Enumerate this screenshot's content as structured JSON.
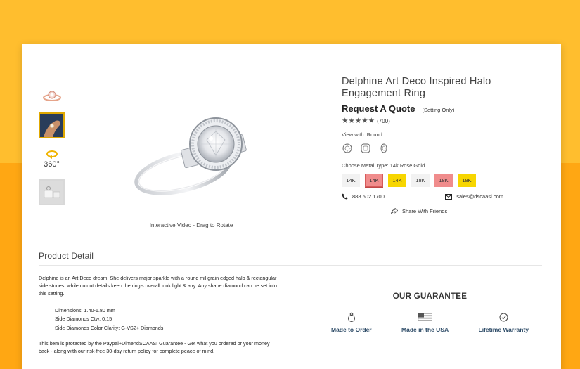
{
  "product": {
    "title": "Delphine Art Deco Inspired Halo Engagement Ring",
    "quote_label": "Request A Quote",
    "setting_note": "(Setting Only)",
    "stars": "★★★★★",
    "review_count": "(700)",
    "rating_stars": 5
  },
  "thumbnails": {
    "rotate_label": "360°"
  },
  "media": {
    "caption": "Interactive Video - Drag to Rotate"
  },
  "view_with": {
    "label": "View with: Round",
    "shapes": [
      "round",
      "cushion",
      "oval"
    ]
  },
  "metal": {
    "label": "Choose Metal Type: 14k Rose Gold",
    "options": [
      {
        "label": "14K",
        "color": "#f2f2f2"
      },
      {
        "label": "14K",
        "color": "#f08c8c",
        "selected": true
      },
      {
        "label": "14K",
        "color": "#f7d600"
      },
      {
        "label": "18K",
        "color": "#f2f2f2"
      },
      {
        "label": "18K",
        "color": "#f08c8c"
      },
      {
        "label": "18K",
        "color": "#f7d600"
      }
    ]
  },
  "contact": {
    "phone": "888.502.1700",
    "email": "sales@dscaasi.com"
  },
  "share": {
    "label": "Share With Friends"
  },
  "detail": {
    "title": "Product Detail",
    "description": "Delphine is an Art Deco dream! She delivers major sparkle with a round millgrain edged halo & rectangular side stones, while cutout details keep the ring's overall look light & airy. Any shape diamond can be set into this setting.",
    "specs": [
      "Dimensions: 1.40-1.80 mm",
      "Side Diamonds Ctw: 0.15",
      "Side Diamonds Color Clarity: G-VS2+ Diamonds"
    ],
    "guarantee_text": "This item is protected by the Paypal+DimendSCAASI Guarantee - Get what you ordered or your money back - along with our risk-free 30-day return policy for complete peace of mind."
  },
  "guarantee": {
    "title": "OUR GUARANTEE",
    "items": [
      {
        "label": "Made to Order",
        "icon": "ring-icon"
      },
      {
        "label": "Made in the USA",
        "icon": "us-flag-icon"
      },
      {
        "label": "Lifetime Warranty",
        "icon": "check-circle-icon"
      }
    ]
  },
  "colors": {
    "background_top": "#ffbe2e",
    "background_bottom": "#ffa713",
    "guarantee_text": "#2d4b67"
  }
}
